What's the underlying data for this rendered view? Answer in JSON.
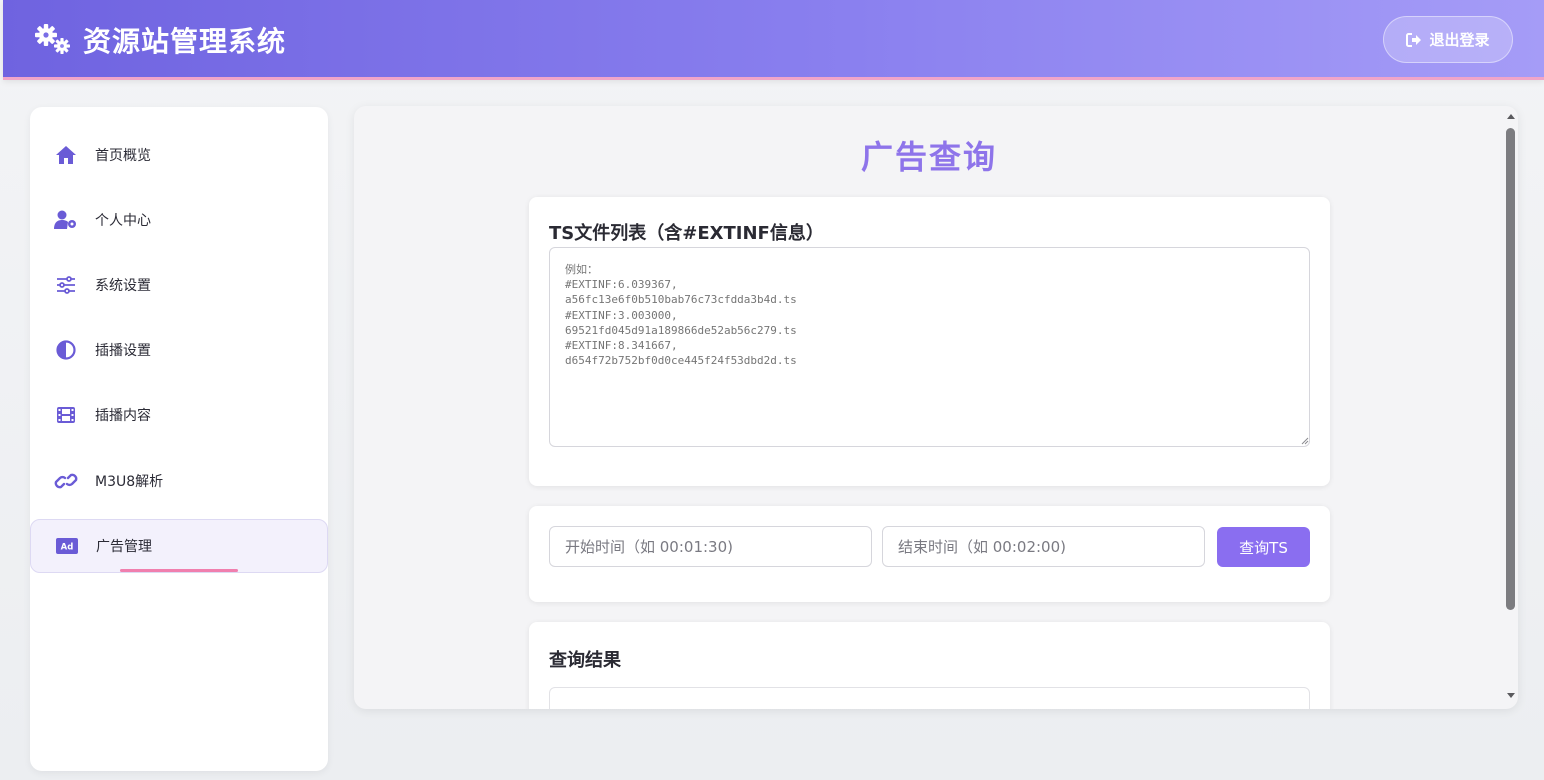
{
  "header": {
    "title": "资源站管理系统",
    "brand_icon": "gears-icon",
    "logout_label": "退出登录",
    "logout_icon": "sign-out-icon"
  },
  "sidebar": {
    "items": [
      {
        "label": "首页概览",
        "icon": "home-icon",
        "active": false
      },
      {
        "label": "个人中心",
        "icon": "user-gear-icon",
        "active": false
      },
      {
        "label": "系统设置",
        "icon": "sliders-icon",
        "active": false
      },
      {
        "label": "插播设置",
        "icon": "half-circle-icon",
        "active": false
      },
      {
        "label": "插播内容",
        "icon": "film-icon",
        "active": false
      },
      {
        "label": "M3U8解析",
        "icon": "link-icon",
        "active": false
      },
      {
        "label": "广告管理",
        "icon": "ad-icon",
        "active": true
      }
    ]
  },
  "main": {
    "page_title": "广告查询",
    "ts_card": {
      "title": "TS文件列表（含#EXTINF信息）",
      "placeholder": "例如：\n#EXTINF:6.039367,\na56fc13e6f0b510bab76c73cfdda3b4d.ts\n#EXTINF:3.003000,\n69521fd045d91a189866de52ab56c279.ts\n#EXTINF:8.341667,\nd654f72b752bf0d0ce445f24f53dbd2d.ts",
      "value": ""
    },
    "query_card": {
      "start_placeholder": "开始时间（如 00:01:30)",
      "end_placeholder": "结束时间（如 00:02:00)",
      "query_button": "查询TS"
    },
    "result_card": {
      "title": "查询结果"
    }
  },
  "colors": {
    "header_gradient_start": "#6f63e0",
    "header_gradient_end": "#a59cf7",
    "accent": "#8a6ef0",
    "title_purple": "#8e74ea",
    "active_underline": "#f07fae",
    "icon_purple": "#6a5bd6"
  }
}
